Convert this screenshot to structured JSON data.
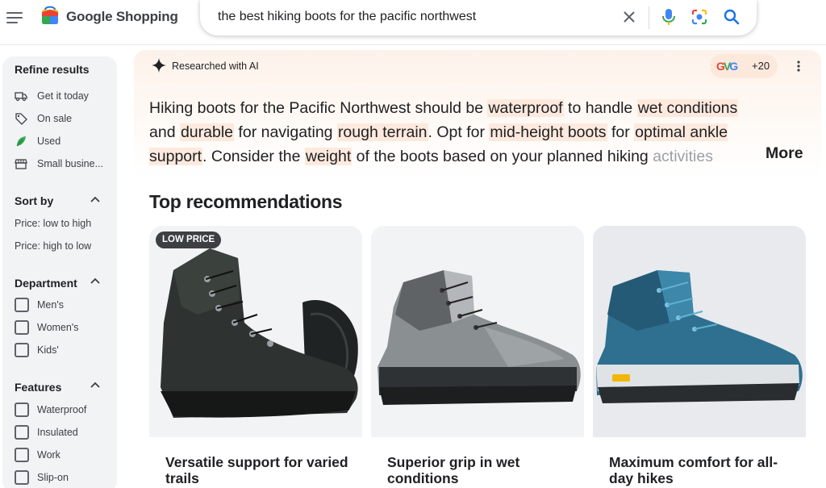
{
  "header": {
    "brand": "Google Shopping",
    "search": {
      "value": "the best hiking boots for the pacific northwest"
    }
  },
  "sidebar": {
    "refine_title": "Refine results",
    "refine_items": [
      {
        "label": "Get it today",
        "icon": "delivery-truck-icon"
      },
      {
        "label": "On sale",
        "icon": "tag-icon"
      },
      {
        "label": "Used",
        "icon": "leaf-icon"
      },
      {
        "label": "Small busine...",
        "icon": "storefront-icon"
      }
    ],
    "sort_title": "Sort by",
    "sort_items": [
      "Price: low to high",
      "Price: high to low"
    ],
    "department_title": "Department",
    "department_items": [
      "Men's",
      "Women's",
      "Kids'"
    ],
    "features_title": "Features",
    "features_items": [
      "Waterproof",
      "Insulated",
      "Work",
      "Slip-on"
    ]
  },
  "ai_panel": {
    "label": "Researched with AI",
    "sources_count": "+20",
    "summary": {
      "s1": "Hiking boots for the Pacific Northwest should be ",
      "h1": "waterproof",
      "s2": " to handle ",
      "h2": "wet conditions",
      "s3": " and ",
      "h3": "durable",
      "s4": " for navigating ",
      "h4": "rough terrain",
      "s5": ". Opt for ",
      "h5": "mid-height boots",
      "s6": " for ",
      "h6": "optimal ankle support",
      "s7": ". Consider the ",
      "h7": "weight",
      "s8": " of the boots based on your planned hiking ",
      "fade": "activities"
    },
    "more_label": "More"
  },
  "recommendations": {
    "title": "Top recommendations",
    "cards": [
      {
        "badge": "LOW PRICE",
        "caption": "Versatile support for varied trails"
      },
      {
        "caption": "Superior grip in wet conditions"
      },
      {
        "caption": "Maximum comfort for all-day hikes"
      }
    ]
  },
  "colors": {
    "highlight": "#fde9dd",
    "sidebar_bg": "#f1f3f4",
    "badge_bg": "#3c4043"
  }
}
